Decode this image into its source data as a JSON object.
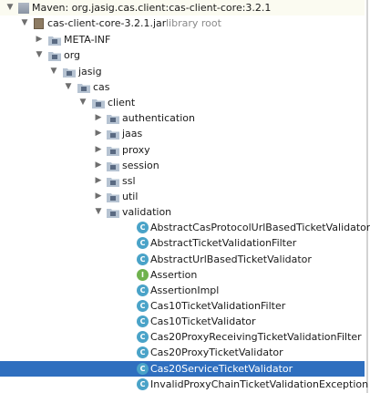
{
  "tree": {
    "library": "Maven: org.jasig.cas.client:cas-client-core:3.2.1",
    "jar": "cas-client-core-3.2.1.jar",
    "jar_suffix": "library root",
    "meta_inf": "META-INF",
    "org": "org",
    "jasig": "jasig",
    "cas": "cas",
    "client": "client",
    "packages": [
      "authentication",
      "jaas",
      "proxy",
      "session",
      "ssl",
      "util",
      "validation"
    ],
    "classes": [
      {
        "name": "AbstractCasProtocolUrlBasedTicketValidator",
        "kind": "class",
        "icon_letter": "C"
      },
      {
        "name": "AbstractTicketValidationFilter",
        "kind": "class",
        "icon_letter": "C"
      },
      {
        "name": "AbstractUrlBasedTicketValidator",
        "kind": "class",
        "icon_letter": "C"
      },
      {
        "name": "Assertion",
        "kind": "interface",
        "icon_letter": "I"
      },
      {
        "name": "AssertionImpl",
        "kind": "class",
        "icon_letter": "C"
      },
      {
        "name": "Cas10TicketValidationFilter",
        "kind": "class",
        "icon_letter": "C"
      },
      {
        "name": "Cas10TicketValidator",
        "kind": "class",
        "icon_letter": "C"
      },
      {
        "name": "Cas20ProxyReceivingTicketValidationFilter",
        "kind": "class",
        "icon_letter": "C"
      },
      {
        "name": "Cas20ProxyTicketValidator",
        "kind": "class",
        "icon_letter": "C"
      },
      {
        "name": "Cas20ServiceTicketValidator",
        "kind": "class",
        "icon_letter": "C",
        "selected": true
      },
      {
        "name": "InvalidProxyChainTicketValidationException",
        "kind": "class",
        "icon_letter": "C"
      }
    ]
  },
  "colors": {
    "selection": "#2f6fbf",
    "folder": "#b6c3d2",
    "class_icon": "#4aa3c8",
    "interface_icon": "#6fb24e"
  }
}
